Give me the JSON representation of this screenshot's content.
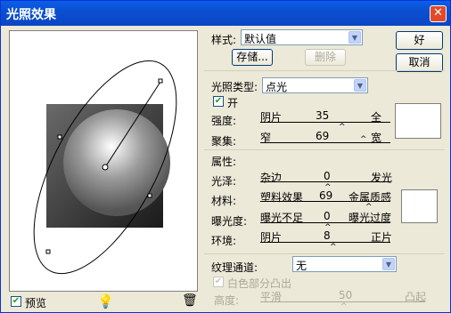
{
  "window": {
    "title": "光照效果",
    "close": "✕"
  },
  "style": {
    "label": "样式:",
    "value": "默认值",
    "save": "存储...",
    "delete": "删除"
  },
  "buttons": {
    "ok": "好",
    "cancel": "取消"
  },
  "light": {
    "type_label": "光照类型:",
    "type_value": "点光",
    "on_label": "开",
    "intensity": {
      "label": "强度:",
      "left": "阴片",
      "right": "全",
      "value": "35",
      "fraction": 0.67
    },
    "focus": {
      "label": "聚集:",
      "left": "窄",
      "right": "宽",
      "value": "69",
      "fraction": 0.84
    }
  },
  "props": {
    "group_label": "属性:",
    "gloss": {
      "label": "光泽:",
      "left": "杂边",
      "right": "发光",
      "value": "0",
      "fraction": 0.5
    },
    "material": {
      "label": "材料:",
      "left": "塑料效果",
      "right": "金属质感",
      "value": "69",
      "fraction": 0.84
    },
    "exposure": {
      "label": "曝光度:",
      "left": "曝光不足",
      "right": "曝光过度",
      "value": "0",
      "fraction": 0.5
    },
    "ambience": {
      "label": "环境:",
      "left": "阴片",
      "right": "正片",
      "value": "8",
      "fraction": 0.54
    }
  },
  "texture": {
    "label": "纹理通道:",
    "value": "无",
    "white_high": "白色部分凸出",
    "height": {
      "label": "高度:",
      "left": "平滑",
      "right": "凸起",
      "value": "50",
      "fraction": 0.5
    }
  },
  "preview": {
    "label": "预览",
    "bulb_icon": "lightbulb-icon",
    "trash_icon": "trash-icon"
  }
}
